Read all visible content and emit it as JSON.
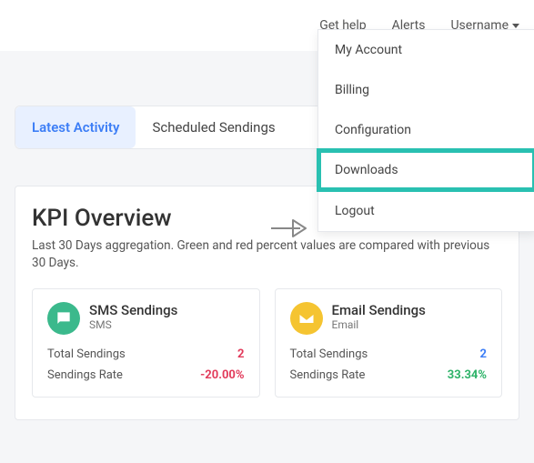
{
  "topbar": {
    "help": "Get help",
    "alerts": "Alerts",
    "username": "Username"
  },
  "dropdown": {
    "items": [
      "My Account",
      "Billing",
      "Configuration",
      "Downloads",
      "Logout"
    ],
    "highlight_index": 3
  },
  "tabs": {
    "items": [
      "Latest Activity",
      "Scheduled Sendings"
    ],
    "active_index": 0
  },
  "kpi": {
    "title": "KPI Overview",
    "desc": "Last 30 Days aggregation. Green and red percent values are compared with previous 30 Days."
  },
  "cards": [
    {
      "title": "SMS Sendings",
      "sub": "SMS",
      "icon_color": "#3bb98c",
      "rows": [
        {
          "label": "Total Sendings",
          "value": "2",
          "class": "red"
        },
        {
          "label": "Sendings Rate",
          "value": "-20.00%",
          "class": "red"
        }
      ]
    },
    {
      "title": "Email Sendings",
      "sub": "Email",
      "icon_color": "#f5c431",
      "rows": [
        {
          "label": "Total Sendings",
          "value": "2",
          "class": "blue"
        },
        {
          "label": "Sendings Rate",
          "value": "33.34%",
          "class": "green"
        }
      ]
    }
  ]
}
